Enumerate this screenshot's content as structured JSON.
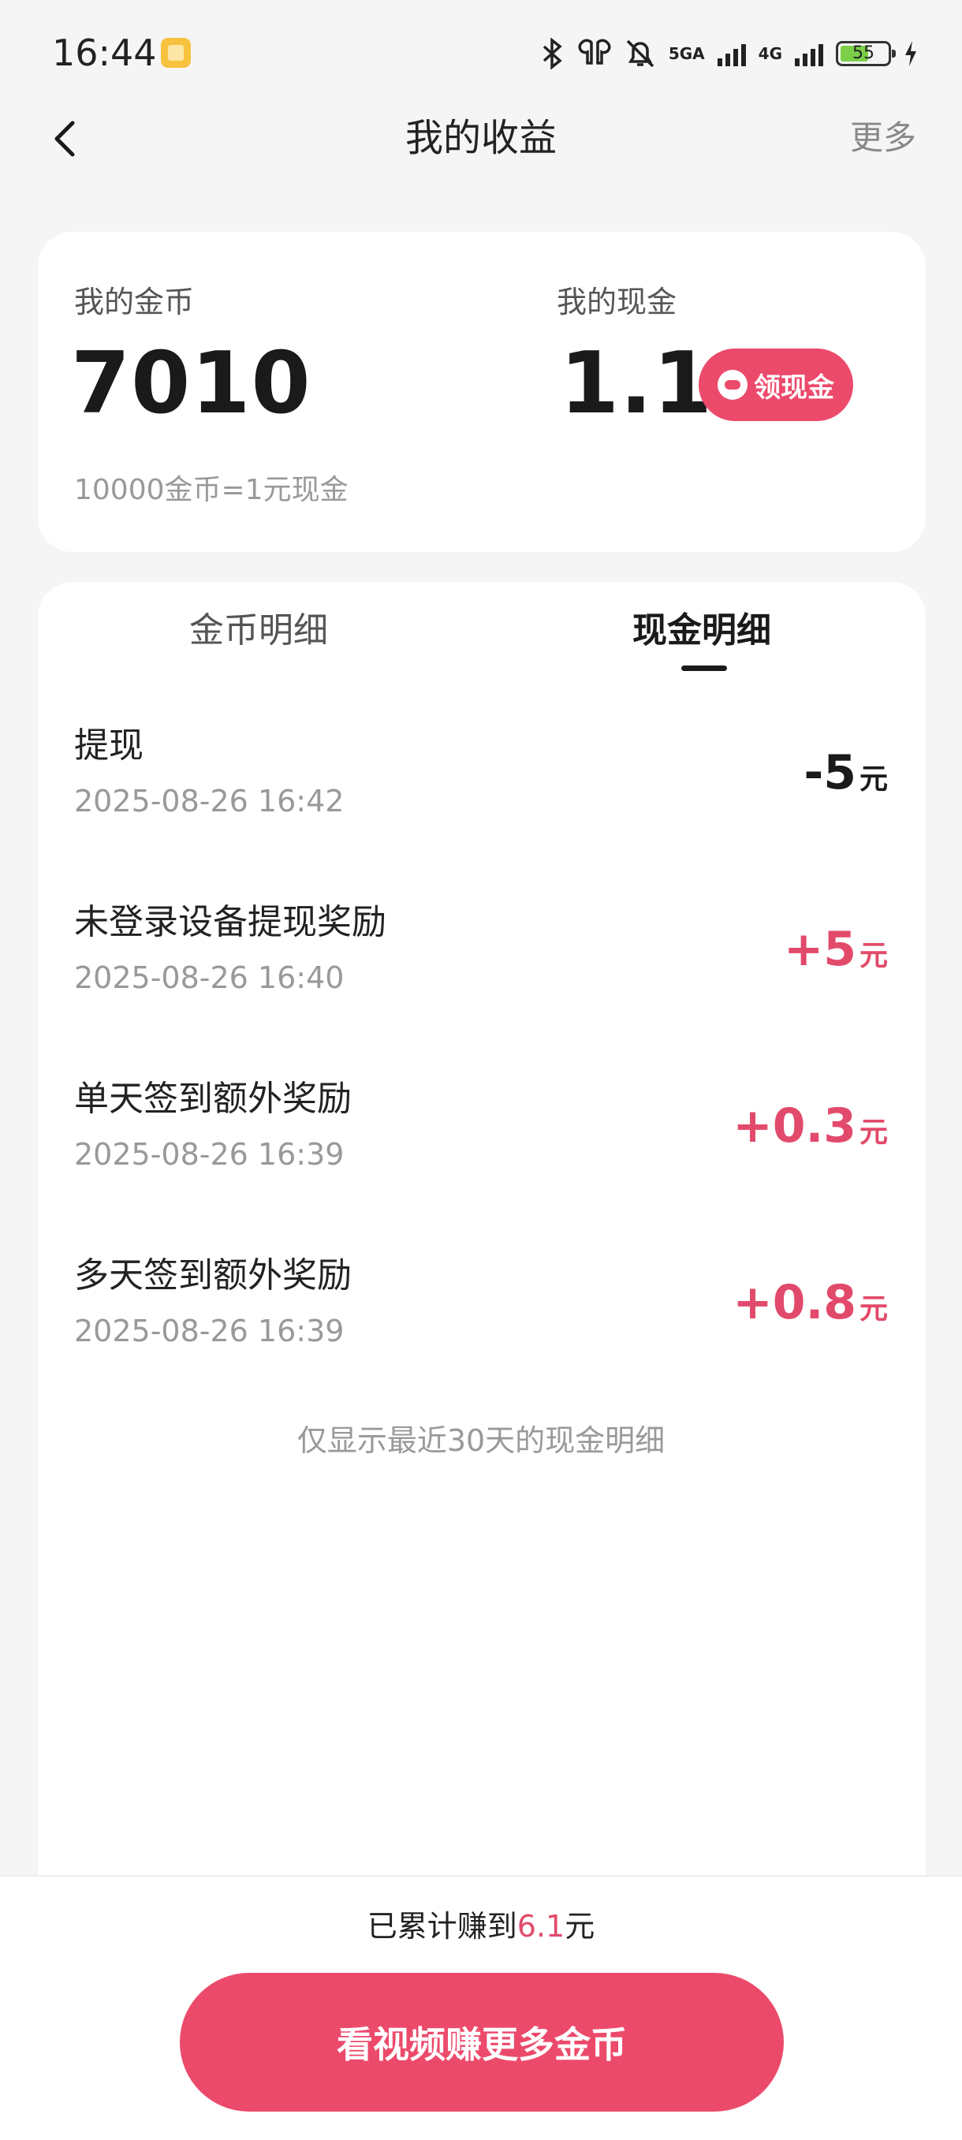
{
  "status_bar": {
    "time": "16:44",
    "net1": "5GA",
    "net2": "4G",
    "battery": "55"
  },
  "header": {
    "title": "我的收益",
    "more": "更多"
  },
  "summary": {
    "coins_label": "我的金币",
    "coins_value": "7010",
    "cash_label": "我的现金",
    "cash_value": "1.1",
    "claim_button": "领现金",
    "rate_text": "10000金币=1元现金"
  },
  "tabs": [
    {
      "label": "金币明细",
      "active": false
    },
    {
      "label": "现金明细",
      "active": true
    }
  ],
  "transactions": [
    {
      "title": "提现",
      "date": "2025-08-26 16:42",
      "amount": "-5",
      "unit": "元"
    },
    {
      "title": "未登录设备提现奖励",
      "date": "2025-08-26 16:40",
      "amount": "+5",
      "unit": "元"
    },
    {
      "title": "单天签到额外奖励",
      "date": "2025-08-26 16:39",
      "amount": "+0.3",
      "unit": "元"
    },
    {
      "title": "多天签到额外奖励",
      "date": "2025-08-26 16:39",
      "amount": "+0.8",
      "unit": "元"
    }
  ],
  "note": "仅显示最近30天的现金明细",
  "footer": {
    "earned_prefix": "已累计赚到",
    "earned_value": "6.1",
    "earned_suffix": "元",
    "button": "看视频赚更多金币"
  },
  "colors": {
    "accent": "#ec4a6b",
    "background": "#f5f5f5"
  }
}
